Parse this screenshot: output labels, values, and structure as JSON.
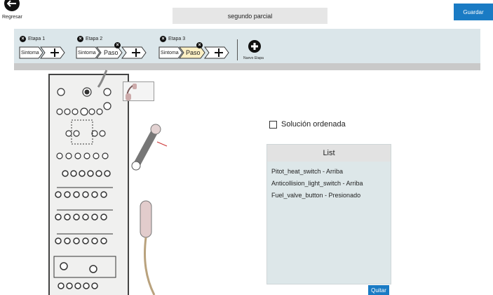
{
  "header": {
    "back_label": "Regresar",
    "title": "segundo parcial",
    "save_label": "Guardar"
  },
  "stages": [
    {
      "label": "Etapa 1",
      "steps": [
        "Sintoma"
      ]
    },
    {
      "label": "Etapa 2",
      "steps": [
        "Sintoma",
        "Paso"
      ]
    },
    {
      "label": "Etapa 3",
      "steps": [
        "Sintoma",
        "Paso"
      ]
    }
  ],
  "new_stage_label": "Nuevo Etapa",
  "ordered_solution_label": "Solución ordenada",
  "list": {
    "title": "List",
    "items": [
      "Pitot_heat_switch - Arriba",
      "Anticollision_light_switch - Arriba",
      "Fuel_valve_button - Presionado"
    ]
  },
  "remove_label": "Quitar",
  "colors": {
    "accent": "#1a7bc4",
    "band": "#dbe6ea",
    "active_step": "#fdf0c4"
  }
}
